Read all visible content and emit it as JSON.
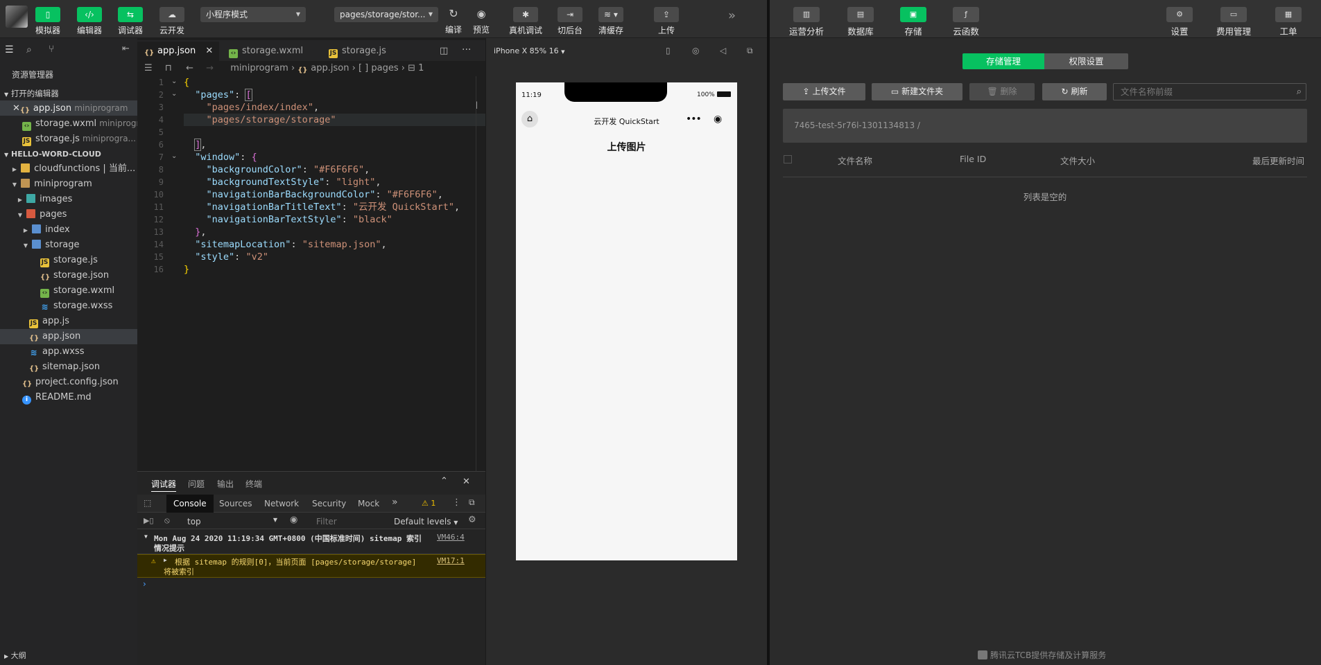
{
  "toolbar": {
    "simulator_label": "模拟器",
    "editor_label": "编辑器",
    "debugger_label": "调试器",
    "cloud_label": "云开发",
    "mode_select": "小程序模式",
    "page_select": "pages/storage/stor...",
    "compile_label": "编译",
    "preview_label": "预览",
    "real_debug_label": "真机调试",
    "background_label": "切后台",
    "clear_cache_label": "清缓存",
    "upload_label": "上传"
  },
  "explorer": {
    "title": "资源管理器",
    "open_editors_header": "打开的编辑器",
    "open_editors": [
      {
        "name": "app.json",
        "path": "miniprogram"
      },
      {
        "name": "storage.wxml",
        "path": "miniprogr..."
      },
      {
        "name": "storage.js",
        "path": "miniprogra..."
      }
    ],
    "project_header": "HELLO-WORD-CLOUD",
    "tree": [
      {
        "name": "cloudfunctions | 当前..."
      },
      {
        "name": "miniprogram"
      },
      {
        "name": "images"
      },
      {
        "name": "pages"
      },
      {
        "name": "index"
      },
      {
        "name": "storage"
      },
      {
        "name": "storage.js"
      },
      {
        "name": "storage.json"
      },
      {
        "name": "storage.wxml"
      },
      {
        "name": "storage.wxss"
      },
      {
        "name": "app.js"
      },
      {
        "name": "app.json"
      },
      {
        "name": "app.wxss"
      },
      {
        "name": "sitemap.json"
      },
      {
        "name": "project.config.json"
      },
      {
        "name": "README.md"
      }
    ],
    "outline_label": "大纲"
  },
  "editor": {
    "tabs": [
      "app.json",
      "storage.wxml",
      "storage.js"
    ],
    "breadcrumb": {
      "folder": "miniprogram",
      "file": "app.json",
      "key": "pages",
      "index": "1"
    },
    "line_numbers": [
      "1",
      "2",
      "3",
      "4",
      "5",
      "6",
      "7",
      "8",
      "9",
      "10",
      "11",
      "12",
      "13",
      "14",
      "15",
      "16"
    ]
  },
  "console": {
    "top_tabs": [
      "调试器",
      "问题",
      "输出",
      "终端"
    ],
    "devtools_tabs": [
      "Console",
      "Sources",
      "Network",
      "Security",
      "Mock"
    ],
    "warn_count": "1",
    "context": "top",
    "filter_placeholder": "Filter",
    "levels": "Default levels",
    "msg1_text": "Mon Aug 24 2020 11:19:34 GMT+0800 (中国标准时间) sitemap 索引",
    "msg1_text2": "情况提示",
    "msg1_source": "VM46:4",
    "msg2_text": "根据 sitemap 的规则[0]，当前页面 [pages/storage/storage]",
    "msg2_text2": "将被索引",
    "msg2_source": "VM17:1"
  },
  "simulator": {
    "device": "iPhone X 85% 16",
    "time": "11:19",
    "battery": "100%",
    "nav_title": "云开发 QuickStart",
    "page_title": "上传图片"
  },
  "cloud": {
    "toolbar": {
      "analytics": "运营分析",
      "database": "数据库",
      "storage": "存储",
      "functions": "云函数",
      "settings": "设置",
      "billing": "费用管理",
      "ticket": "工单"
    },
    "tabs": {
      "storage_mgmt": "存储管理",
      "permissions": "权限设置"
    },
    "upload_file": "上传文件",
    "new_folder": "新建文件夹",
    "delete": "删除",
    "refresh": "刷新",
    "search_placeholder": "文件名称前缀",
    "path": "7465-test-5r76l-1301134813 /",
    "columns": {
      "name": "文件名称",
      "file_id": "File ID",
      "size": "文件大小",
      "updated": "最后更新时间"
    },
    "empty": "列表是空的",
    "footer": "腾讯云TCB提供存储及计算服务"
  }
}
